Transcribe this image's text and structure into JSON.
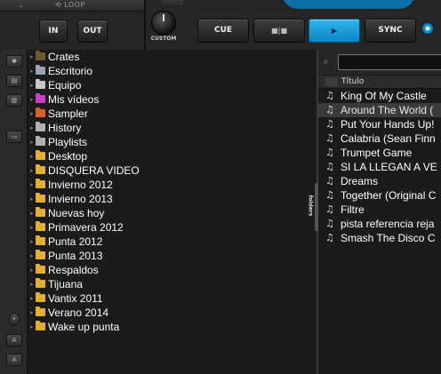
{
  "deck": {
    "loop_label": "LOOP",
    "in_label": "IN",
    "out_label": "OUT",
    "custom_label": "CUSTOM",
    "cue_label": "CUE",
    "pause_label": "■|■",
    "play_label": "▶",
    "sync_label": "SYNC",
    "accent_color": "#1aa6e6"
  },
  "tree": [
    {
      "label": "Crates",
      "icon": "crates-folder-icon",
      "color": "#6b5a2e"
    },
    {
      "label": "Escritorio",
      "icon": "desktop-icon",
      "color": "#9aa6b0"
    },
    {
      "label": "Equipo",
      "icon": "computer-icon",
      "color": "#c7c7c7"
    },
    {
      "label": "Mis vídeos",
      "icon": "videos-folder-icon",
      "color": "#c842c8"
    },
    {
      "label": "Sampler",
      "icon": "sampler-icon",
      "color": "#d8622a"
    },
    {
      "label": "History",
      "icon": "history-icon",
      "color": "#b0b0b0"
    },
    {
      "label": "Playlists",
      "icon": "playlists-icon",
      "color": "#b0b0b0"
    },
    {
      "label": "Desktop",
      "icon": "folder-icon",
      "color": "#e0b030"
    },
    {
      "label": "DISQUERA VIDEO",
      "icon": "folder-icon",
      "color": "#e0b030"
    },
    {
      "label": "Invierno 2012",
      "icon": "folder-icon",
      "color": "#e0b030"
    },
    {
      "label": "Invierno 2013",
      "icon": "folder-icon",
      "color": "#e0b030"
    },
    {
      "label": "Nuevas hoy",
      "icon": "folder-icon",
      "color": "#e0b030"
    },
    {
      "label": "Primavera 2012",
      "icon": "folder-icon",
      "color": "#e0b030"
    },
    {
      "label": "Punta 2012",
      "icon": "folder-icon",
      "color": "#e0b030"
    },
    {
      "label": "Punta 2013",
      "icon": "folder-icon",
      "color": "#e0b030"
    },
    {
      "label": "Respaldos",
      "icon": "folder-icon",
      "color": "#e0b030"
    },
    {
      "label": "Tijuana",
      "icon": "folder-icon",
      "color": "#e0b030"
    },
    {
      "label": "Vantix 2011",
      "icon": "folder-icon",
      "color": "#e0b030"
    },
    {
      "label": "Verano 2014",
      "icon": "folder-icon",
      "color": "#e0b030"
    },
    {
      "label": "Wake up punta",
      "icon": "folder-icon",
      "color": "#e0b030"
    }
  ],
  "folders_tab_label": "folders",
  "filelist": {
    "column_title": "Título",
    "search_value": "",
    "rows": [
      "King Of My Castle",
      "Around The World (",
      "Put Your Hands Up!",
      "Calabria (Sean Finn",
      "Trumpet Game",
      "SI LA LLEGAN A VE",
      "Dreams",
      "Together (Original C",
      "Filtre",
      "pista referencia reja",
      "Smash The Disco C"
    ],
    "selected_index": 1
  }
}
